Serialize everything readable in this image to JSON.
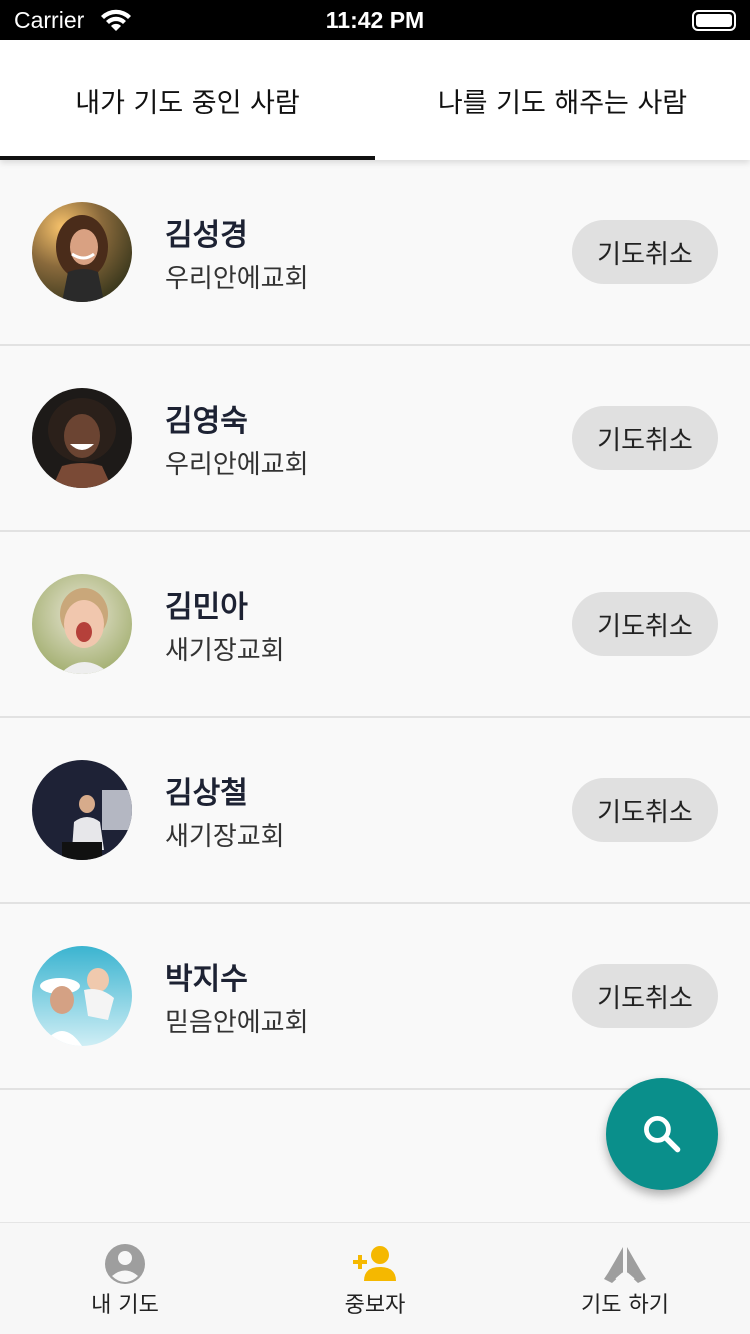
{
  "status_bar": {
    "carrier": "Carrier",
    "time": "11:42 PM"
  },
  "tabs": [
    {
      "label": "내가 기도 중인 사람",
      "active": true
    },
    {
      "label": "나를 기도 해주는 사람",
      "active": false
    }
  ],
  "people": [
    {
      "name": "김성경",
      "church": "우리안에교회",
      "button": "기도취소"
    },
    {
      "name": "김영숙",
      "church": "우리안에교회",
      "button": "기도취소"
    },
    {
      "name": "김민아",
      "church": "새기장교회",
      "button": "기도취소"
    },
    {
      "name": "김상철",
      "church": "새기장교회",
      "button": "기도취소"
    },
    {
      "name": "박지수",
      "church": "믿음안에교회",
      "button": "기도취소"
    }
  ],
  "fab": {
    "icon": "search-icon",
    "color": "#0a8f8b"
  },
  "bottom_nav": [
    {
      "label": "내 기도",
      "icon": "account-circle-icon",
      "active": false
    },
    {
      "label": "중보자",
      "icon": "person-add-icon",
      "active": true
    },
    {
      "label": "기도 하기",
      "icon": "praying-hands-icon",
      "active": false
    }
  ],
  "colors": {
    "accent": "#0a8f8b",
    "nav_active": "#f5b800",
    "nav_inactive": "#9e9e9e"
  }
}
